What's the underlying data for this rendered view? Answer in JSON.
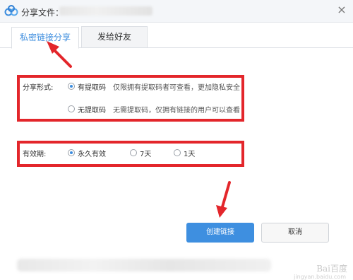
{
  "window": {
    "title": "分享文件：",
    "close_glyph": "×",
    "app_icon": "cloud-icon"
  },
  "tabs": [
    {
      "label": "私密链接分享",
      "active": true
    },
    {
      "label": "发给好友",
      "active": false
    }
  ],
  "share_form": {
    "label": "分享形式:",
    "options": [
      {
        "label": "有提取码",
        "checked": true,
        "description": "仅限拥有提取码者可查看，更加隐私安全"
      },
      {
        "label": "无提取码",
        "checked": false,
        "description": "无需提取码，仅拥有链接的用户可以查看"
      }
    ]
  },
  "validity": {
    "label": "有效期:",
    "options": [
      {
        "label": "永久有效",
        "checked": true
      },
      {
        "label": "7天",
        "checked": false
      },
      {
        "label": "1天",
        "checked": false
      }
    ]
  },
  "buttons": {
    "create": "创建链接",
    "cancel": "取消"
  },
  "watermark": {
    "brand": "Bai百度",
    "sub": "jingyan.baidu.com"
  },
  "colors": {
    "accent": "#3e8fe0",
    "highlight": "#e3262b"
  }
}
